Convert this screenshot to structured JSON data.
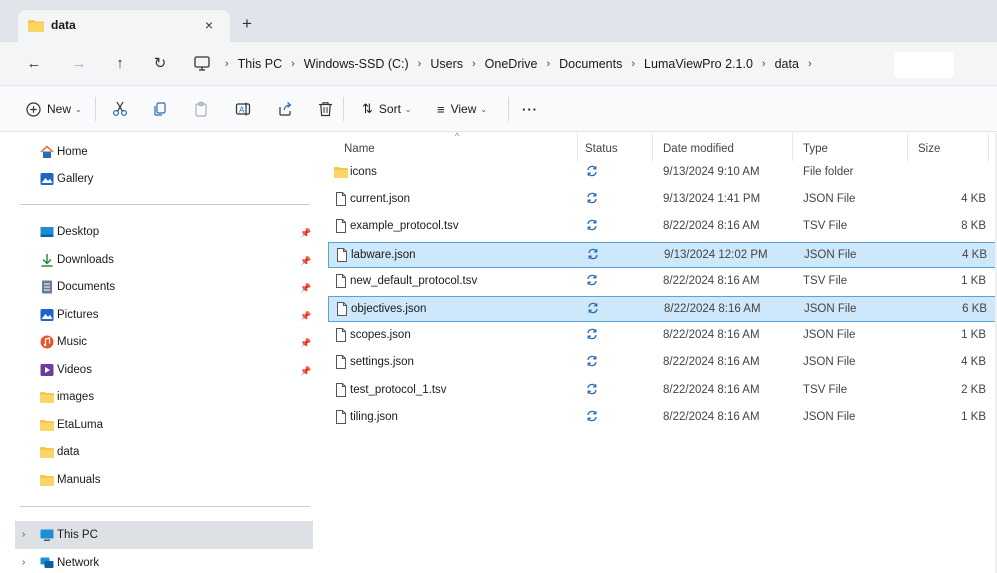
{
  "tab": {
    "title": "data",
    "close": "×",
    "new": "+"
  },
  "nav": {
    "back": "←",
    "forward": "→",
    "up": "↑",
    "refresh": "↻",
    "breadcrumbs": [
      "This PC",
      "Windows-SSD (C:)",
      "Users",
      "OneDrive",
      "Documents",
      "LumaViewPro 2.1.0",
      "data"
    ],
    "separator": "›"
  },
  "toolbar": {
    "new_label": "New",
    "sort_label": "Sort",
    "view_label": "View",
    "more_label": "···"
  },
  "sidebar": {
    "home": "Home",
    "gallery": "Gallery",
    "quick_access": [
      {
        "label": "Desktop",
        "icon": "desktop-icon",
        "pinned": true
      },
      {
        "label": "Downloads",
        "icon": "download-icon",
        "pinned": true
      },
      {
        "label": "Documents",
        "icon": "documents-icon",
        "pinned": true
      },
      {
        "label": "Pictures",
        "icon": "pictures-icon",
        "pinned": true
      },
      {
        "label": "Music",
        "icon": "music-icon",
        "pinned": true
      },
      {
        "label": "Videos",
        "icon": "videos-icon",
        "pinned": true
      },
      {
        "label": "images",
        "icon": "folder-icon",
        "pinned": false
      },
      {
        "label": "EtaLuma",
        "icon": "folder-icon",
        "pinned": false
      },
      {
        "label": "data",
        "icon": "folder-icon",
        "pinned": false
      },
      {
        "label": "Manuals",
        "icon": "folder-icon",
        "pinned": false
      }
    ],
    "this_pc": "This PC",
    "network": "Network",
    "pin_glyph": "📌"
  },
  "columns": {
    "name": "Name",
    "status": "Status",
    "date": "Date modified",
    "type": "Type",
    "size": "Size"
  },
  "files": [
    {
      "name": "icons",
      "kind": "folder",
      "date": "9/13/2024 9:10 AM",
      "type": "File folder",
      "size": "",
      "selected": false
    },
    {
      "name": "current.json",
      "kind": "file",
      "date": "9/13/2024 1:41 PM",
      "type": "JSON File",
      "size": "4 KB",
      "selected": false
    },
    {
      "name": "example_protocol.tsv",
      "kind": "file",
      "date": "8/22/2024 8:16 AM",
      "type": "TSV File",
      "size": "8 KB",
      "selected": false
    },
    {
      "name": "labware.json",
      "kind": "file",
      "date": "9/13/2024 12:02 PM",
      "type": "JSON File",
      "size": "4 KB",
      "selected": true
    },
    {
      "name": "new_default_protocol.tsv",
      "kind": "file",
      "date": "8/22/2024 8:16 AM",
      "type": "TSV File",
      "size": "1 KB",
      "selected": false
    },
    {
      "name": "objectives.json",
      "kind": "file",
      "date": "8/22/2024 8:16 AM",
      "type": "JSON File",
      "size": "6 KB",
      "selected": true
    },
    {
      "name": "scopes.json",
      "kind": "file",
      "date": "8/22/2024 8:16 AM",
      "type": "JSON File",
      "size": "1 KB",
      "selected": false
    },
    {
      "name": "settings.json",
      "kind": "file",
      "date": "8/22/2024 8:16 AM",
      "type": "JSON File",
      "size": "4 KB",
      "selected": false
    },
    {
      "name": "test_protocol_1.tsv",
      "kind": "file",
      "date": "8/22/2024 8:16 AM",
      "type": "TSV File",
      "size": "2 KB",
      "selected": false
    },
    {
      "name": "tiling.json",
      "kind": "file",
      "date": "8/22/2024 8:16 AM",
      "type": "JSON File",
      "size": "1 KB",
      "selected": false
    }
  ],
  "colors": {
    "folder_yellow": "#f8c74a",
    "sync_blue": "#2b6cb0",
    "selection_bg": "#cde8fb",
    "selection_border": "#5aa3da"
  }
}
